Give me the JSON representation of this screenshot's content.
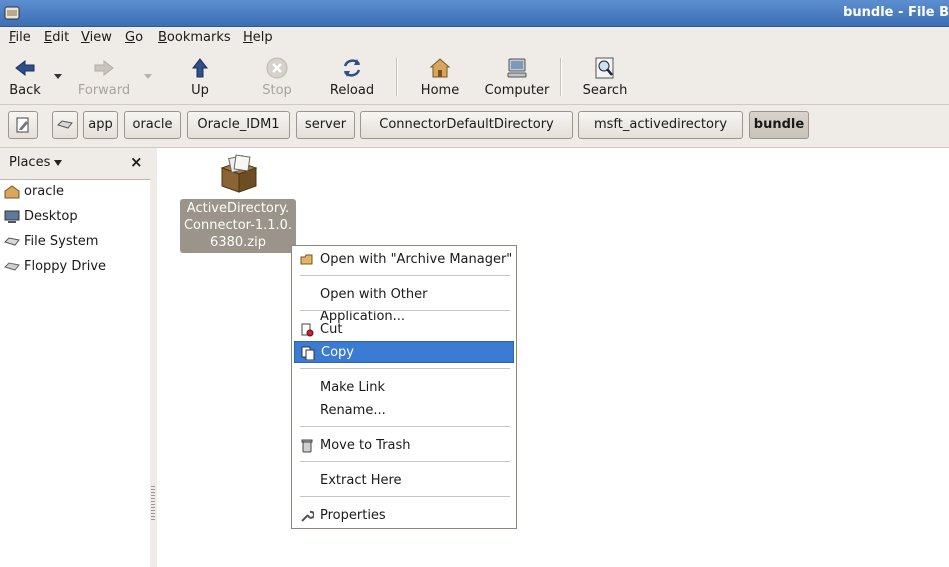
{
  "window": {
    "title": "bundle - File B"
  },
  "menubar": [
    {
      "label": "File",
      "mn": "F",
      "rest": "ile"
    },
    {
      "label": "Edit",
      "mn": "E",
      "rest": "dit"
    },
    {
      "label": "View",
      "mn": "V",
      "rest": "iew"
    },
    {
      "label": "Go",
      "mn": "G",
      "rest": "o"
    },
    {
      "label": "Bookmarks",
      "mn": "B",
      "rest": "ookmarks"
    },
    {
      "label": "Help",
      "mn": "H",
      "rest": "elp"
    }
  ],
  "toolbar": {
    "back": "Back",
    "forward": "Forward",
    "up": "Up",
    "stop": "Stop",
    "reload": "Reload",
    "home": "Home",
    "computer": "Computer",
    "search": "Search"
  },
  "location": {
    "crumbs": [
      "app",
      "oracle",
      "Oracle_IDM1",
      "server",
      "ConnectorDefaultDirectory",
      "msft_activedirectory",
      "bundle"
    ]
  },
  "sidebar": {
    "header": "Places",
    "close": "×",
    "items": [
      {
        "label": "oracle",
        "icon": "home-folder-icon"
      },
      {
        "label": "Desktop",
        "icon": "desktop-icon"
      },
      {
        "label": "File System",
        "icon": "drive-icon"
      },
      {
        "label": "Floppy Drive",
        "icon": "floppy-icon"
      }
    ]
  },
  "file": {
    "line1": "ActiveDirectory.",
    "line2": "Connector-1.1.0.",
    "line3": "6380.zip"
  },
  "context_menu": {
    "open_archive": "Open with \"Archive Manager\"",
    "open_other": "Open with Other Application...",
    "cut": "Cut",
    "copy": "Copy",
    "make_link": "Make Link",
    "rename": "Rename...",
    "trash": "Move to Trash",
    "extract": "Extract Here",
    "properties": "Properties"
  },
  "colors": {
    "titlebar": "#3b6fb4",
    "selection": "#3b7bd2",
    "file_label_bg": "#9b948a"
  }
}
